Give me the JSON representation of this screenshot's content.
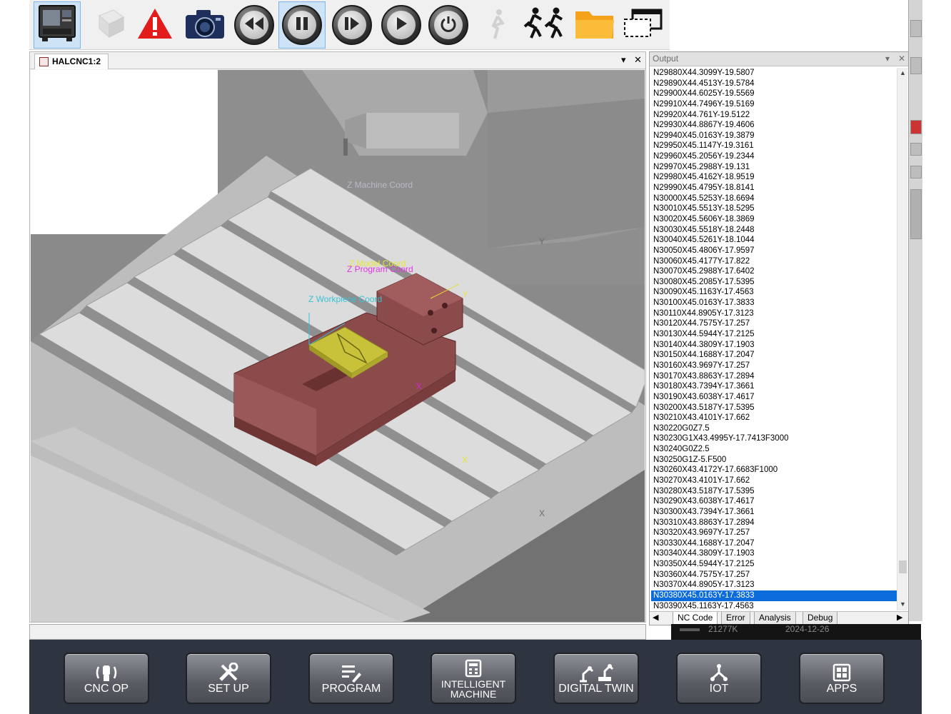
{
  "toolbar": {
    "items": [
      "machine-icon",
      "cube-icon",
      "warning-icon",
      "camera-icon",
      "rewind-icon",
      "pause-icon",
      "step-forward-icon",
      "play-icon",
      "power-icon",
      "walk-icon",
      "run-icon",
      "folder-icon",
      "window-icon"
    ]
  },
  "viewer": {
    "tab_label": "HALCNC1:2",
    "dropdown_glyph": "▾",
    "close_glyph": "✕",
    "scene_labels": {
      "machine_coord": "Z Machine Coord",
      "model_coord": "Z Model Coord",
      "program_coord": "Z Program Coord",
      "workpiece_coord": "Z Workpiece Coord",
      "axis_y": "Y",
      "axis_x": "X"
    }
  },
  "output": {
    "title": "Output",
    "lines": [
      "N29880X44.3099Y-19.5807",
      "N29890X44.4513Y-19.5784",
      "N29900X44.6025Y-19.5569",
      "N29910X44.7496Y-19.5169",
      "N29920X44.761Y-19.5122",
      "N29930X44.8867Y-19.4606",
      "N29940X45.0163Y-19.3879",
      "N29950X45.1147Y-19.3161",
      "N29960X45.2056Y-19.2344",
      "N29970X45.2988Y-19.131",
      "N29980X45.4162Y-18.9519",
      "N29990X45.4795Y-18.8141",
      "N30000X45.5253Y-18.6694",
      "N30010X45.5513Y-18.5295",
      "N30020X45.5606Y-18.3869",
      "N30030X45.5518Y-18.2448",
      "N30040X45.5261Y-18.1044",
      "N30050X45.4806Y-17.9597",
      "N30060X45.4177Y-17.822",
      "N30070X45.2988Y-17.6402",
      "N30080X45.2085Y-17.5395",
      "N30090X45.1163Y-17.4563",
      "N30100X45.0163Y-17.3833",
      "N30110X44.8905Y-17.3123",
      "N30120X44.7575Y-17.257",
      "N30130X44.5944Y-17.2125",
      "N30140X44.3809Y-17.1903",
      "N30150X44.1688Y-17.2047",
      "N30160X43.9697Y-17.257",
      "N30170X43.8863Y-17.2894",
      "N30180X43.7394Y-17.3661",
      "N30190X43.6038Y-17.4617",
      "N30200X43.5187Y-17.5395",
      "N30210X43.4101Y-17.662",
      "N30220G0Z7.5",
      "N30230G1X43.4995Y-17.7413F3000",
      "N30240G0Z2.5",
      "N30250G1Z-5.F500",
      "N30260X43.4172Y-17.6683F1000",
      "N30270X43.4101Y-17.662",
      "N30280X43.5187Y-17.5395",
      "N30290X43.6038Y-17.4617",
      "N30300X43.7394Y-17.3661",
      "N30310X43.8863Y-17.2894",
      "N30320X43.9697Y-17.257",
      "N30330X44.1688Y-17.2047",
      "N30340X44.3809Y-17.1903",
      "N30350X44.5944Y-17.2125",
      "N30360X44.7575Y-17.257",
      "N30370X44.8905Y-17.3123",
      "N30380X45.0163Y-17.3833",
      "N30390X45.1163Y-17.4563"
    ],
    "selected_index": 50,
    "tabs": [
      "NC Code",
      "Error",
      "Analysis",
      "Debug"
    ],
    "active_tab": "NC Code"
  },
  "info_strip": {
    "left": "21277K",
    "right": "2024-12-26"
  },
  "menu": {
    "buttons": [
      {
        "label": "CNC OP",
        "icon": "hand-icon"
      },
      {
        "label": "SET UP",
        "icon": "tools-icon"
      },
      {
        "label": "PROGRAM",
        "icon": "program-icon"
      },
      {
        "label": "INTELLIGENT MACHINE",
        "icon": "calculator-icon"
      },
      {
        "label": "DIGITAL TWIN",
        "icon": "robot-arm-icon"
      },
      {
        "label": "IOT",
        "icon": "network-icon"
      },
      {
        "label": "APPS",
        "icon": "apps-icon"
      }
    ]
  },
  "colors": {
    "vise": "#8c4b4b",
    "workpiece": "#c7c23a",
    "table": "#d8d8d8",
    "selection": "#0c6cdc",
    "menu_bg": "#2e3440"
  }
}
